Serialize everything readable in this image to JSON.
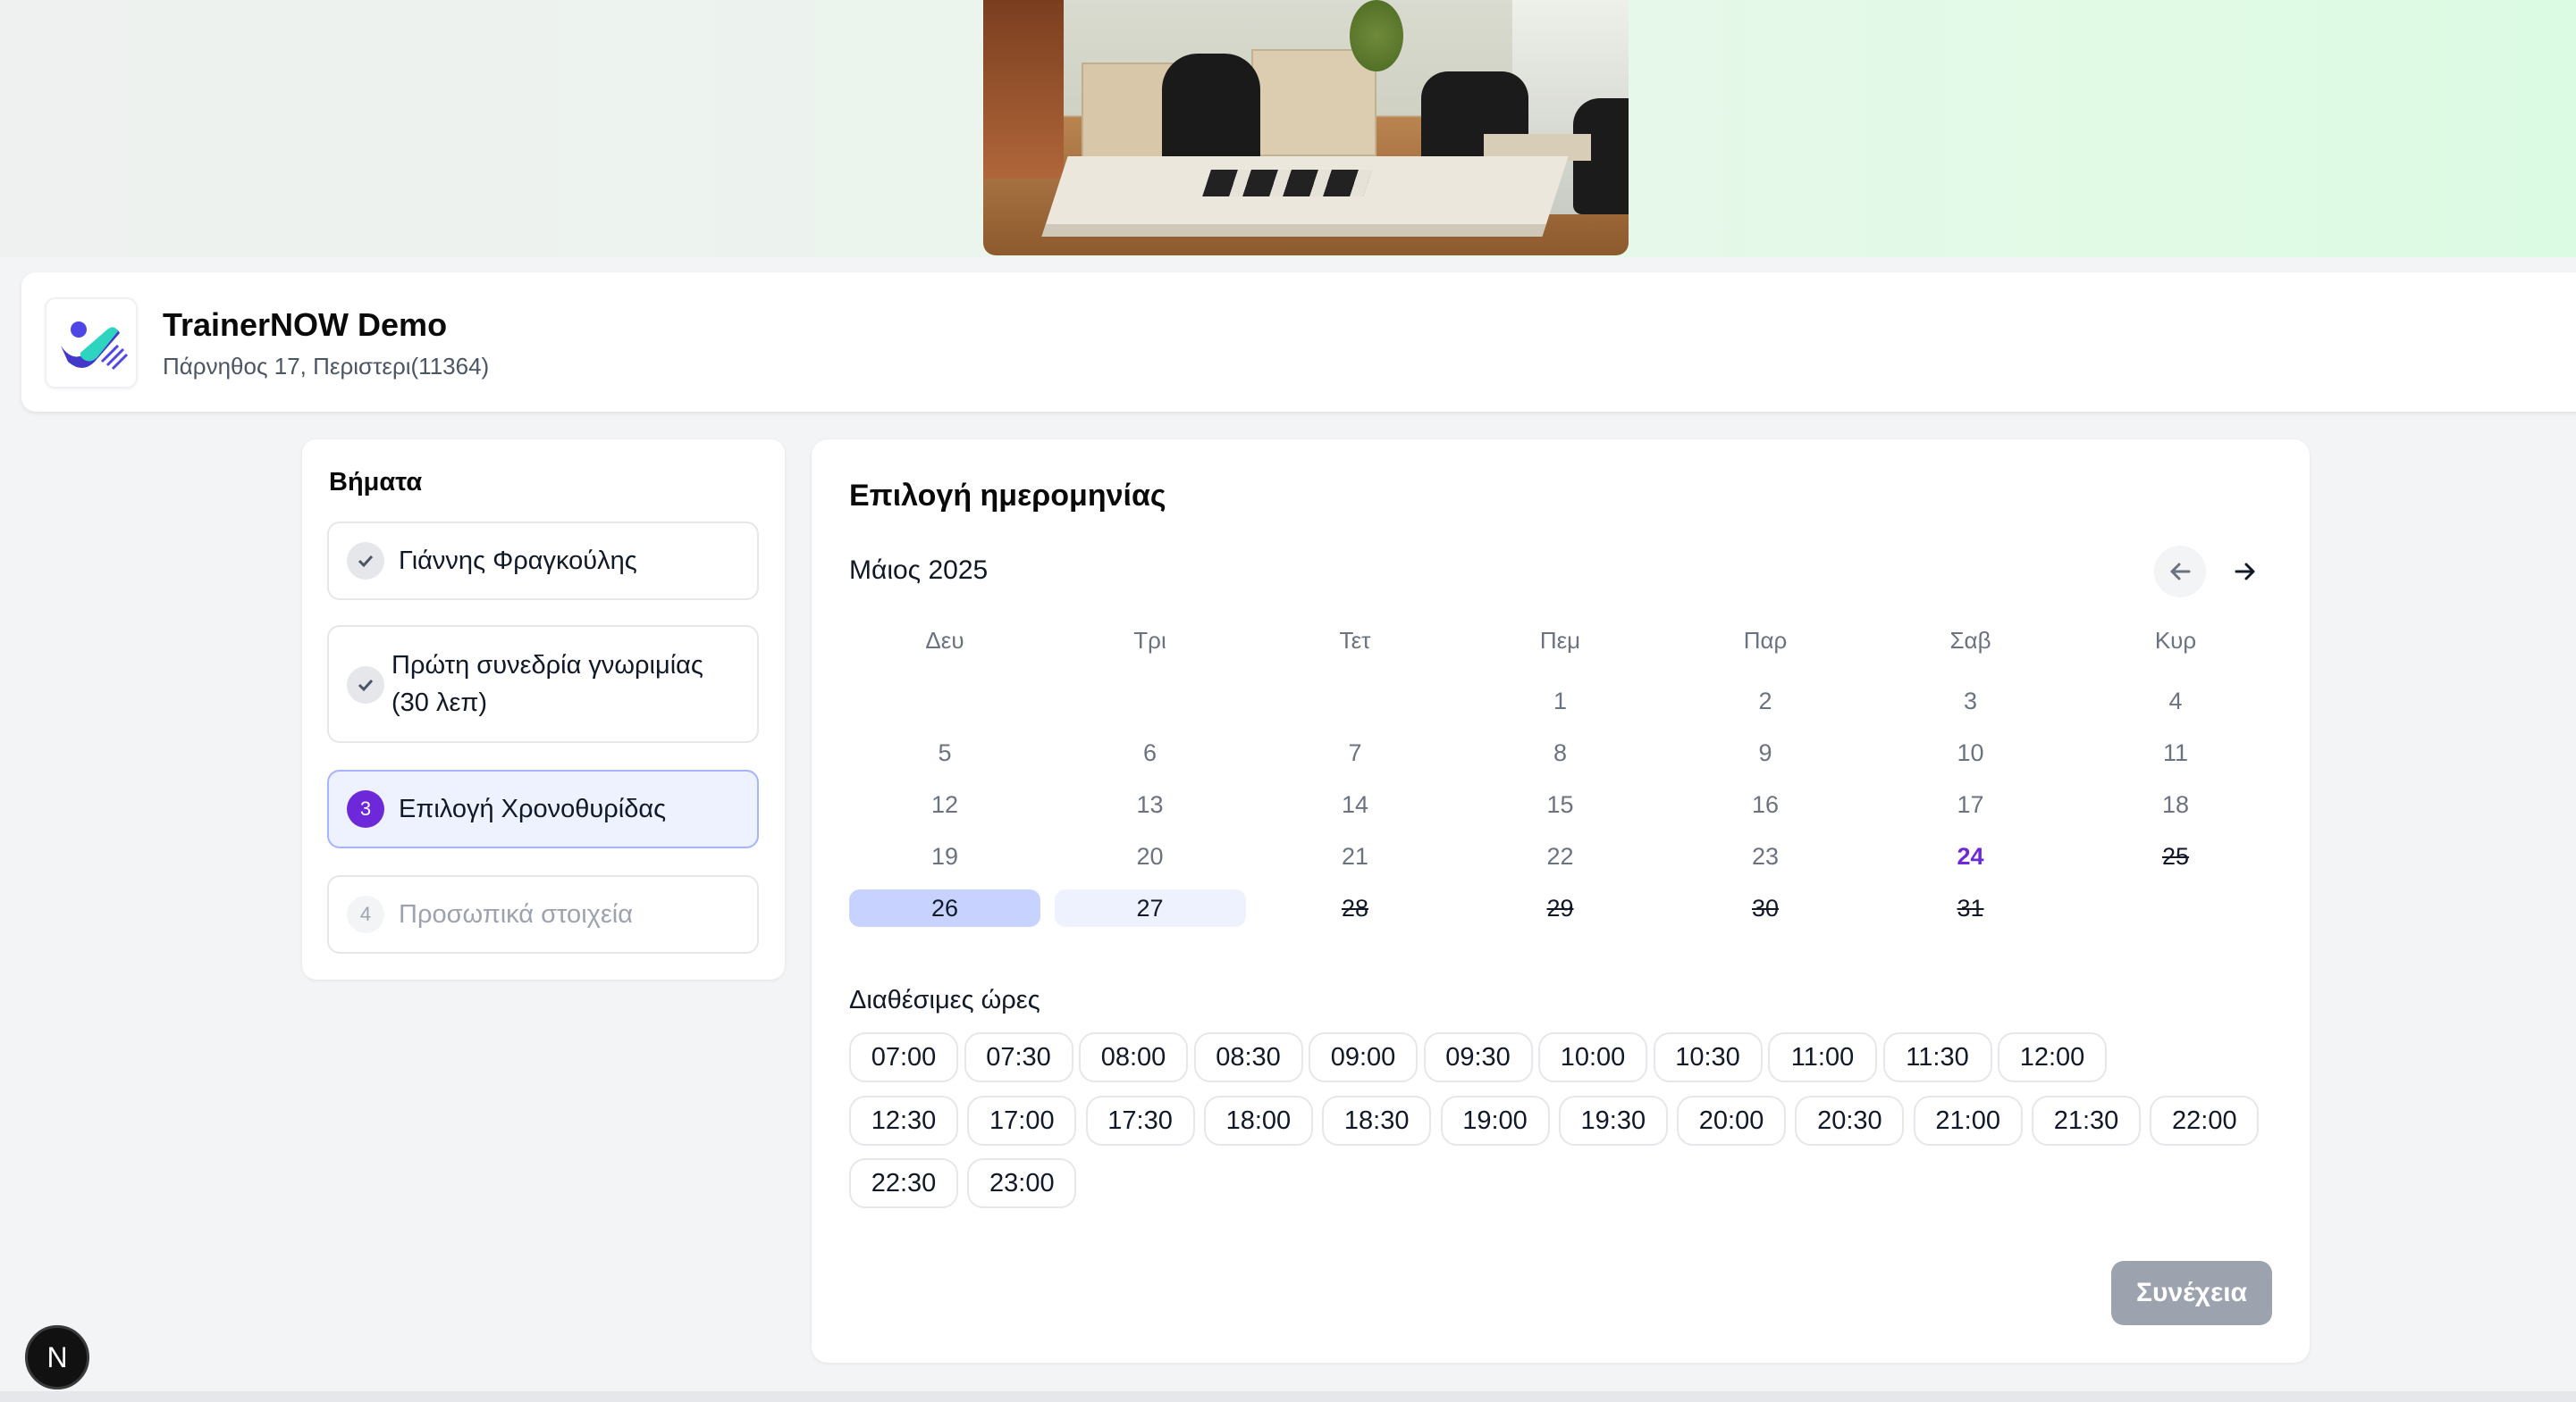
{
  "business": {
    "name": "TrainerNOW Demo",
    "address": "Πάρνηθος 17, Περιστερι(11364)"
  },
  "steps": {
    "title": "Βήματα",
    "items": [
      {
        "label": "Γιάννης Φραγκούλης",
        "state": "done",
        "badge": "✓"
      },
      {
        "label_line1": "Πρώτη συνεδρία γνωριμίας",
        "label_line2": "(30 λεπ)",
        "state": "done",
        "badge": "✓"
      },
      {
        "label": "Επιλογή Χρονοθυρίδας",
        "state": "active",
        "badge": "3"
      },
      {
        "label": "Προσωπικά στοιχεία",
        "state": "upcoming",
        "badge": "4"
      }
    ]
  },
  "calendar": {
    "title": "Επιλογή ημερομηνίας",
    "month": "Μάιος 2025",
    "prev_icon": "arrow-left-icon",
    "next_icon": "arrow-right-icon",
    "weekdays": [
      "Δευ",
      "Τρι",
      "Τετ",
      "Πεμ",
      "Παρ",
      "Σαβ",
      "Κυρ"
    ],
    "weeks": [
      [
        null,
        null,
        null,
        {
          "d": "1"
        },
        {
          "d": "2"
        },
        {
          "d": "3"
        },
        {
          "d": "4"
        }
      ],
      [
        {
          "d": "5"
        },
        {
          "d": "6"
        },
        {
          "d": "7"
        },
        {
          "d": "8"
        },
        {
          "d": "9"
        },
        {
          "d": "10"
        },
        {
          "d": "11"
        }
      ],
      [
        {
          "d": "12"
        },
        {
          "d": "13"
        },
        {
          "d": "14"
        },
        {
          "d": "15"
        },
        {
          "d": "16"
        },
        {
          "d": "17"
        },
        {
          "d": "18"
        }
      ],
      [
        {
          "d": "19"
        },
        {
          "d": "20"
        },
        {
          "d": "21"
        },
        {
          "d": "22"
        },
        {
          "d": "23"
        },
        {
          "d": "24",
          "s": "today"
        },
        {
          "d": "25",
          "s": "struck"
        }
      ],
      [
        {
          "d": "26",
          "s": "selected"
        },
        {
          "d": "27",
          "s": "available"
        },
        {
          "d": "28",
          "s": "struck"
        },
        {
          "d": "29",
          "s": "struck"
        },
        {
          "d": "30",
          "s": "struck"
        },
        {
          "d": "31",
          "s": "struck"
        },
        null
      ]
    ]
  },
  "times": {
    "title": "Διαθέσιμες ώρες",
    "rows": [
      [
        "07:00",
        "07:30",
        "08:00",
        "08:30",
        "09:00",
        "09:30",
        "10:00",
        "10:30",
        "11:00",
        "11:30",
        "12:00"
      ],
      [
        "12:30",
        "17:00",
        "17:30",
        "18:00",
        "18:30",
        "19:00",
        "19:30",
        "20:00",
        "20:30",
        "21:00",
        "21:30",
        "22:00"
      ],
      [
        "22:30",
        "23:00"
      ]
    ]
  },
  "continue_label": "Συνέχεια",
  "dev_badge": "N",
  "colors": {
    "accent": "#6d28d9",
    "selected_day": "#c7d2fe",
    "available_day": "#eef2ff",
    "disabled_button": "#9ca3af"
  }
}
